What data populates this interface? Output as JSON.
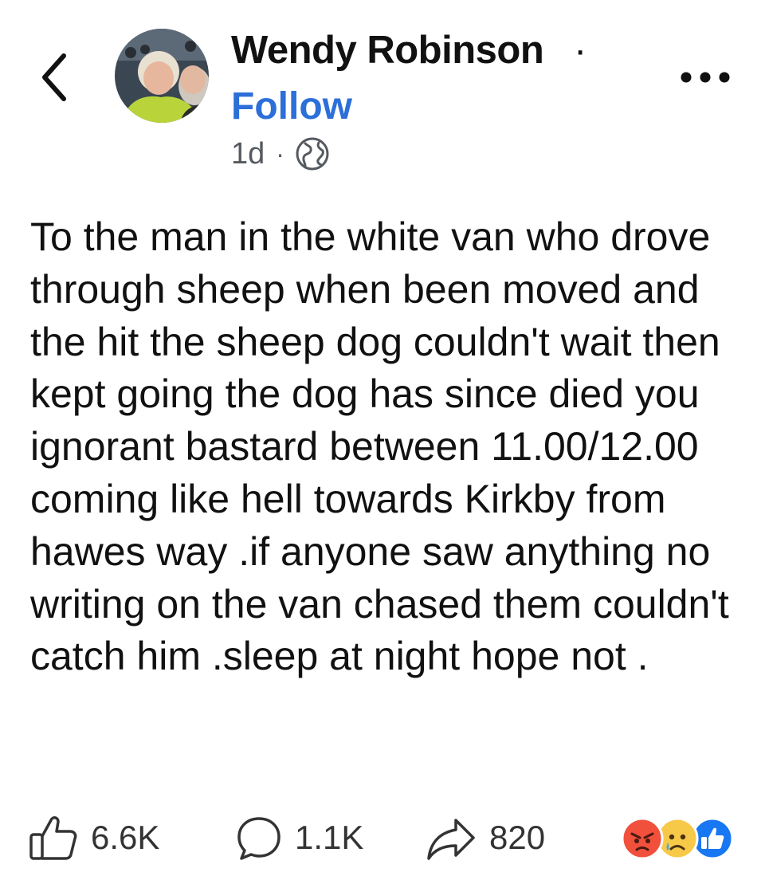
{
  "post": {
    "author": "Wendy Robinson",
    "name_separator": "·",
    "follow_label": "Follow",
    "time": "1d",
    "meta_separator": "·",
    "privacy_icon": "globe-icon",
    "text": "To the man in the white van who drove through sheep when been moved and the hit the sheep dog couldn't wait then kept going the dog has since died you ignorant bastard between 11.00/12.00 coming like hell towards Kirkby from hawes way .if anyone saw anything no writing on the van chased them couldn't catch him .sleep at night hope not ."
  },
  "header": {
    "back_icon": "chevron-left-icon",
    "more_icon": "more-options-icon"
  },
  "engagement": {
    "likes": "6.6K",
    "comments": "1.1K",
    "shares": "820",
    "reactions": [
      "angry",
      "sad",
      "like"
    ]
  },
  "colors": {
    "follow": "#2d6fd9",
    "text": "#111111",
    "meta": "#555a60",
    "like_reaction": "#1877f2",
    "angry_reaction": "#f0503c",
    "sad_reaction": "#f7c948"
  }
}
